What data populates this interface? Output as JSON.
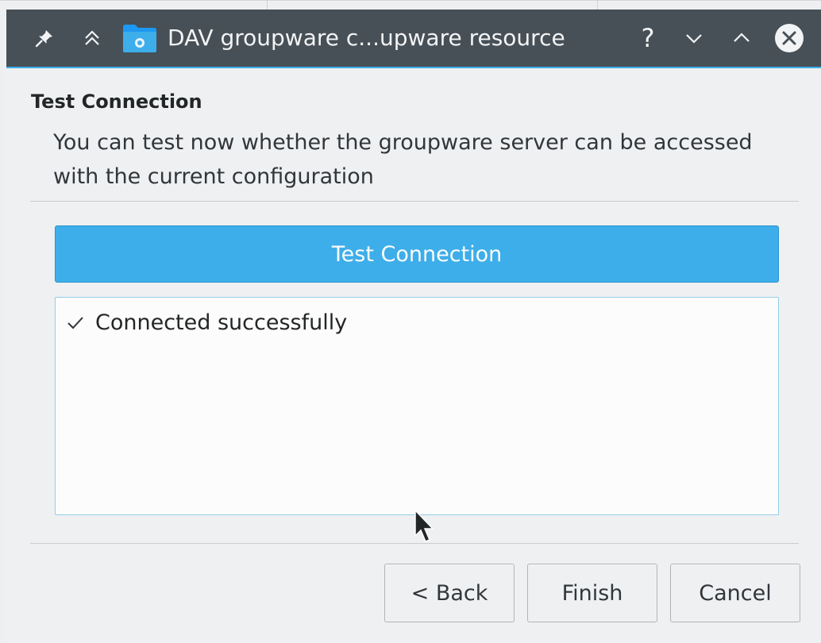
{
  "window": {
    "title": "DAV groupware c...upware resource",
    "accent_color": "#3daee9",
    "titlebar_color": "#475057"
  },
  "titlebar_buttons": {
    "help_label": "?"
  },
  "page": {
    "heading": "Test Connection",
    "description": "You can test now whether the groupware server can be accessed with the current configuration"
  },
  "test_button": {
    "label": "Test Connection"
  },
  "results": {
    "items": [
      {
        "icon": "checkmark-icon",
        "text": "Connected successfully"
      }
    ]
  },
  "footer": {
    "back_label": "< Back",
    "finish_label": "Finish",
    "cancel_label": "Cancel"
  }
}
